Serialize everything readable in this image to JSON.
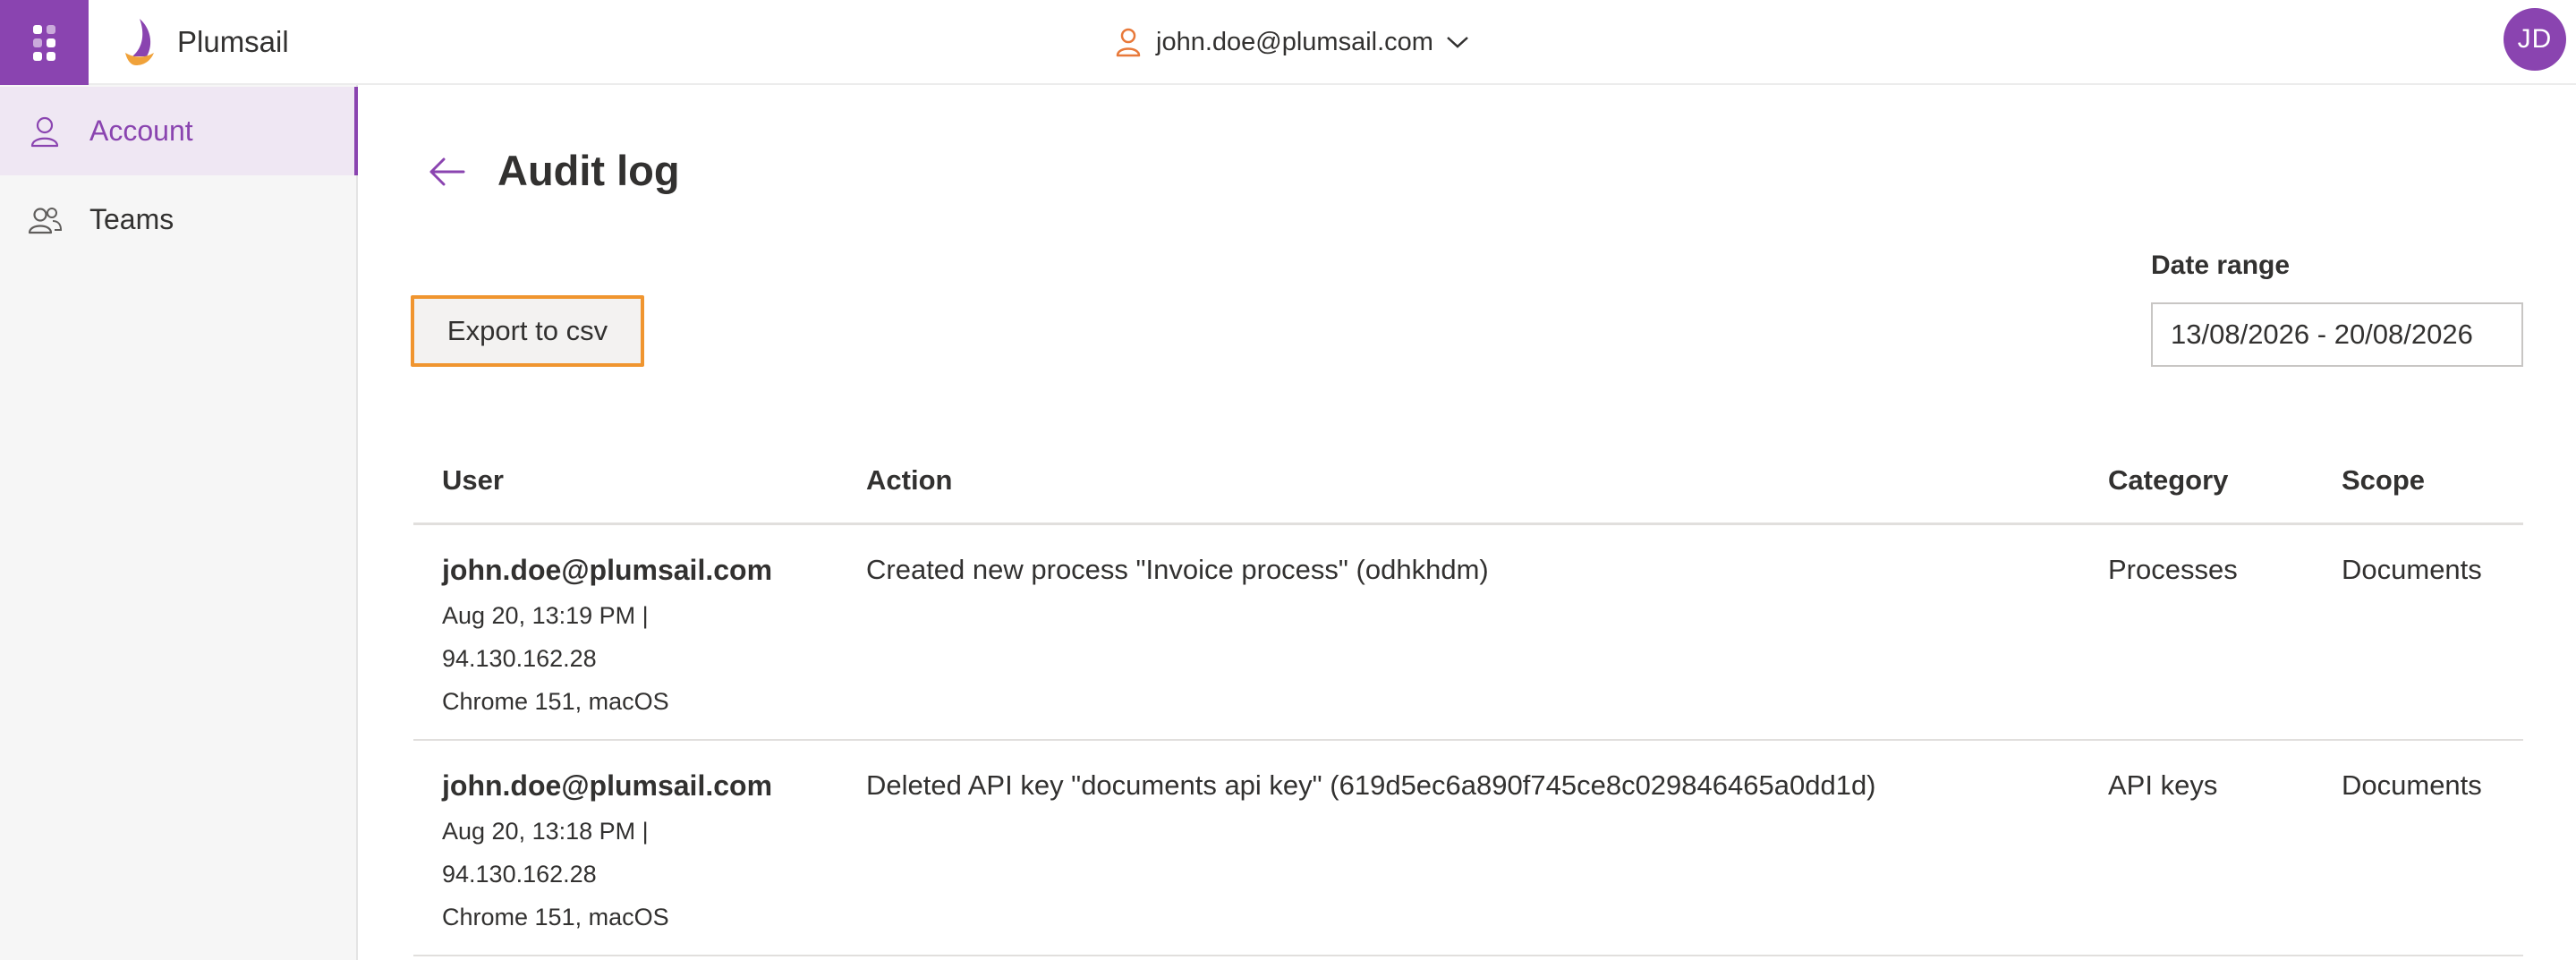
{
  "header": {
    "brand_name": "Plumsail",
    "account_email": "john.doe@plumsail.com",
    "avatar_initials": "JD",
    "icons": {
      "apps": "waffle-icon",
      "account": "person-icon",
      "dropdown": "chevron-down-icon"
    }
  },
  "sidebar": {
    "items": [
      {
        "label": "Account",
        "icon": "person-icon",
        "active": true
      },
      {
        "label": "Teams",
        "icon": "people-icon",
        "active": false
      }
    ]
  },
  "main": {
    "title": "Audit log",
    "back_icon": "arrow-left-icon",
    "export_label": "Export to csv",
    "date_range_label": "Date range",
    "date_range_value": "13/08/2026 - 20/08/2026"
  },
  "table": {
    "columns": [
      "User",
      "Action",
      "Category",
      "Scope"
    ],
    "rows": [
      {
        "user": "john.doe@plumsail.com",
        "when": "Aug 20, 13:19 PM |",
        "ip": "94.130.162.28",
        "client": "Chrome 151, macOS",
        "action": "Created new process \"Invoice process\" (odhkhdm)",
        "category": "Processes",
        "scope": "Documents"
      },
      {
        "user": "john.doe@plumsail.com",
        "when": "Aug 20, 13:18 PM |",
        "ip": "94.130.162.28",
        "client": "Chrome 151, macOS",
        "action": "Deleted API key \"documents api key\" (619d5ec6a890f745ce8c029846465a0dd1d)",
        "category": "API keys",
        "scope": "Documents"
      }
    ]
  },
  "colors": {
    "accent": "#8a44b0",
    "highlight_border": "#f0952f",
    "logo_orange": "#f0a23a"
  }
}
